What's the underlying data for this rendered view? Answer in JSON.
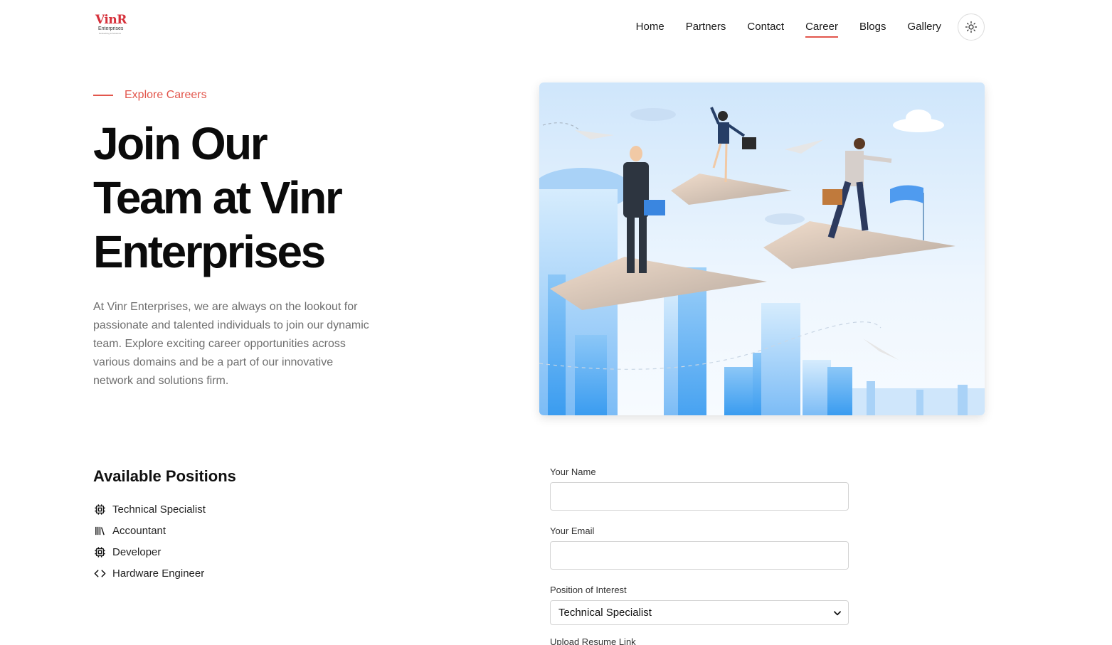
{
  "brand": {
    "logo_text": "VinR",
    "logo_sub": "Enterprises",
    "logo_tag": "Networking & Solutions"
  },
  "nav": {
    "items": [
      {
        "label": "Home",
        "active": false
      },
      {
        "label": "Partners",
        "active": false
      },
      {
        "label": "Contact",
        "active": false
      },
      {
        "label": "Career",
        "active": true
      },
      {
        "label": "Blogs",
        "active": false
      },
      {
        "label": "Gallery",
        "active": false
      }
    ],
    "theme_icon": "sun-icon"
  },
  "hero": {
    "eyebrow": "Explore Careers",
    "title_line1": "Join Our",
    "title_line2": "Team at Vinr",
    "title_line3": "Enterprises",
    "description": "At Vinr Enterprises, we are always on the lookout for passionate and talented individuals to join our dynamic team. Explore exciting career opportunities across various domains and be a part of our innovative network and solutions firm."
  },
  "positions": {
    "title": "Available Positions",
    "items": [
      {
        "label": "Technical Specialist",
        "icon": "cpu-icon"
      },
      {
        "label": "Accountant",
        "icon": "books-icon"
      },
      {
        "label": "Developer",
        "icon": "cpu-icon"
      },
      {
        "label": "Hardware Engineer",
        "icon": "code-icon"
      }
    ]
  },
  "form": {
    "name_label": "Your Name",
    "name_value": "",
    "email_label": "Your Email",
    "email_value": "",
    "position_label": "Position of Interest",
    "position_value": "Technical Specialist",
    "resume_label": "Upload Resume Link"
  },
  "colors": {
    "accent": "#e2564c",
    "text": "#0b0b0b",
    "muted": "#6f6f6f"
  }
}
